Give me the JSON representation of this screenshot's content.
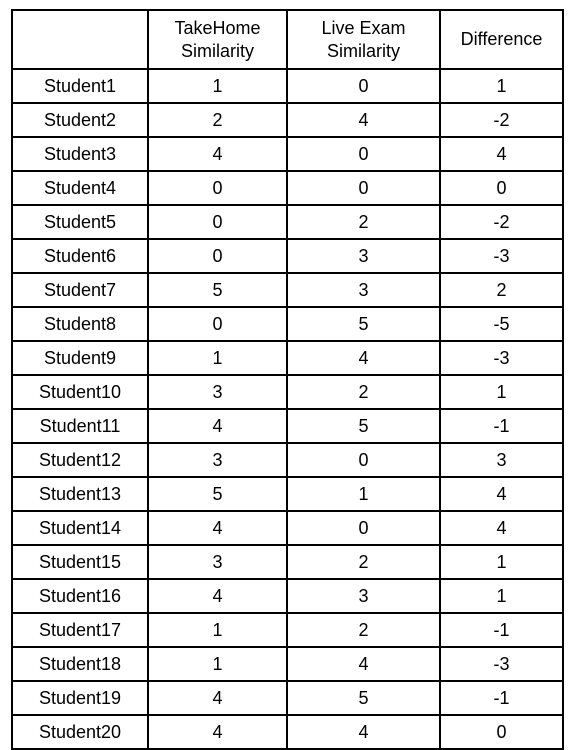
{
  "table": {
    "columns": [
      {
        "id": "student",
        "label_lines": []
      },
      {
        "id": "takehome",
        "label_lines": [
          "TakeHome",
          "Similarity"
        ]
      },
      {
        "id": "liveexam",
        "label_lines": [
          "Live Exam",
          "Similarity"
        ]
      },
      {
        "id": "difference",
        "label_lines": [
          "Difference"
        ]
      }
    ],
    "rows": [
      {
        "student": "Student1",
        "takehome": "1",
        "liveexam": "0",
        "difference": "1"
      },
      {
        "student": "Student2",
        "takehome": "2",
        "liveexam": "4",
        "difference": "-2"
      },
      {
        "student": "Student3",
        "takehome": "4",
        "liveexam": "0",
        "difference": "4"
      },
      {
        "student": "Student4",
        "takehome": "0",
        "liveexam": "0",
        "difference": "0"
      },
      {
        "student": "Student5",
        "takehome": "0",
        "liveexam": "2",
        "difference": "-2"
      },
      {
        "student": "Student6",
        "takehome": "0",
        "liveexam": "3",
        "difference": "-3"
      },
      {
        "student": "Student7",
        "takehome": "5",
        "liveexam": "3",
        "difference": "2"
      },
      {
        "student": "Student8",
        "takehome": "0",
        "liveexam": "5",
        "difference": "-5"
      },
      {
        "student": "Student9",
        "takehome": "1",
        "liveexam": "4",
        "difference": "-3"
      },
      {
        "student": "Student10",
        "takehome": "3",
        "liveexam": "2",
        "difference": "1"
      },
      {
        "student": "Student11",
        "takehome": "4",
        "liveexam": "5",
        "difference": "-1"
      },
      {
        "student": "Student12",
        "takehome": "3",
        "liveexam": "0",
        "difference": "3"
      },
      {
        "student": "Student13",
        "takehome": "5",
        "liveexam": "1",
        "difference": "4"
      },
      {
        "student": "Student14",
        "takehome": "4",
        "liveexam": "0",
        "difference": "4"
      },
      {
        "student": "Student15",
        "takehome": "3",
        "liveexam": "2",
        "difference": "1"
      },
      {
        "student": "Student16",
        "takehome": "4",
        "liveexam": "3",
        "difference": "1"
      },
      {
        "student": "Student17",
        "takehome": "1",
        "liveexam": "2",
        "difference": "-1"
      },
      {
        "student": "Student18",
        "takehome": "1",
        "liveexam": "4",
        "difference": "-3"
      },
      {
        "student": "Student19",
        "takehome": "4",
        "liveexam": "5",
        "difference": "-1"
      },
      {
        "student": "Student20",
        "takehome": "4",
        "liveexam": "4",
        "difference": "0"
      }
    ]
  },
  "chart_data": {
    "type": "table",
    "title": "",
    "columns": [
      "",
      "TakeHome Similarity",
      "Live Exam Similarity",
      "Difference"
    ],
    "categories": [
      "Student1",
      "Student2",
      "Student3",
      "Student4",
      "Student5",
      "Student6",
      "Student7",
      "Student8",
      "Student9",
      "Student10",
      "Student11",
      "Student12",
      "Student13",
      "Student14",
      "Student15",
      "Student16",
      "Student17",
      "Student18",
      "Student19",
      "Student20"
    ],
    "series": [
      {
        "name": "TakeHome Similarity",
        "values": [
          1,
          2,
          4,
          0,
          0,
          0,
          5,
          0,
          1,
          3,
          4,
          3,
          5,
          4,
          3,
          4,
          1,
          1,
          4,
          4
        ]
      },
      {
        "name": "Live Exam Similarity",
        "values": [
          0,
          4,
          0,
          0,
          2,
          3,
          3,
          5,
          4,
          2,
          5,
          0,
          1,
          0,
          2,
          3,
          2,
          4,
          5,
          4
        ]
      },
      {
        "name": "Difference",
        "values": [
          1,
          -2,
          4,
          0,
          -2,
          -3,
          2,
          -5,
          -3,
          1,
          -1,
          3,
          4,
          4,
          1,
          1,
          -1,
          -3,
          -1,
          0
        ]
      }
    ]
  }
}
